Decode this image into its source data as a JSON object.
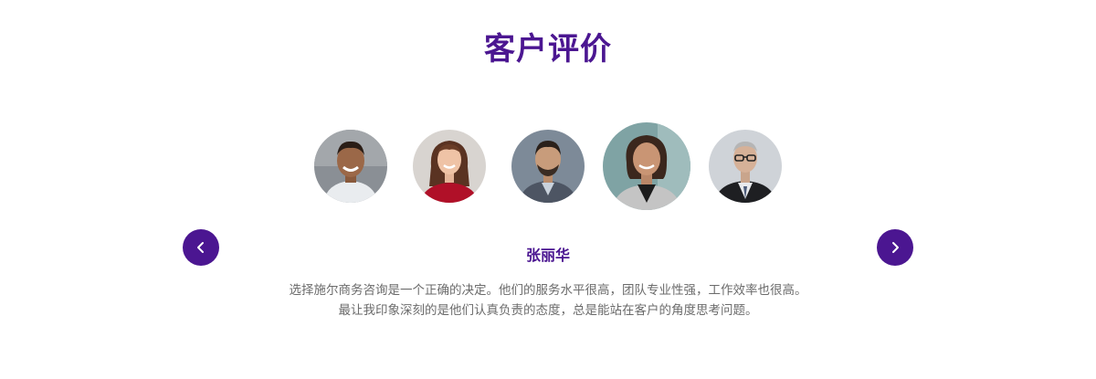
{
  "section": {
    "title": "客户评价"
  },
  "carousel": {
    "prev_icon": "chevron-left-icon",
    "next_icon": "chevron-right-icon",
    "accent_color": "#4b1691",
    "avatars": [
      {
        "name": "avatar-man-smiling",
        "active": false
      },
      {
        "name": "avatar-woman-red-sweater",
        "active": false
      },
      {
        "name": "avatar-man-beard",
        "active": false
      },
      {
        "name": "avatar-woman-gray-blazer",
        "active": true
      },
      {
        "name": "avatar-man-glasses",
        "active": false
      }
    ]
  },
  "testimonial": {
    "name": "张丽华",
    "quote_line1": "选择施尔商务咨询是一个正确的决定。他们的服务水平很高，团队专业性强，工作效率也很高。",
    "quote_line2": "最让我印象深刻的是他们认真负责的态度，总是能站在客户的角度思考问题。"
  }
}
